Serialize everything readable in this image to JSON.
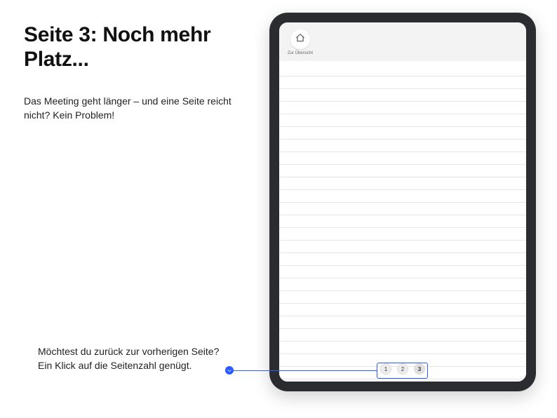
{
  "marketing": {
    "headline": "Seite 3: Noch mehr Platz...",
    "subhead": "Das Meeting geht länger – und eine Seite reicht nicht? Kein Problem!",
    "tip": "Möchtest du zurück zur vorherigen Seite? Ein Klick auf die Seitenzahl genügt."
  },
  "app": {
    "home_label": "Zur Übersicht",
    "pages": [
      "1",
      "2",
      "3"
    ],
    "active_page_index": 2
  },
  "callout": {
    "accent": "#2c5cff"
  }
}
